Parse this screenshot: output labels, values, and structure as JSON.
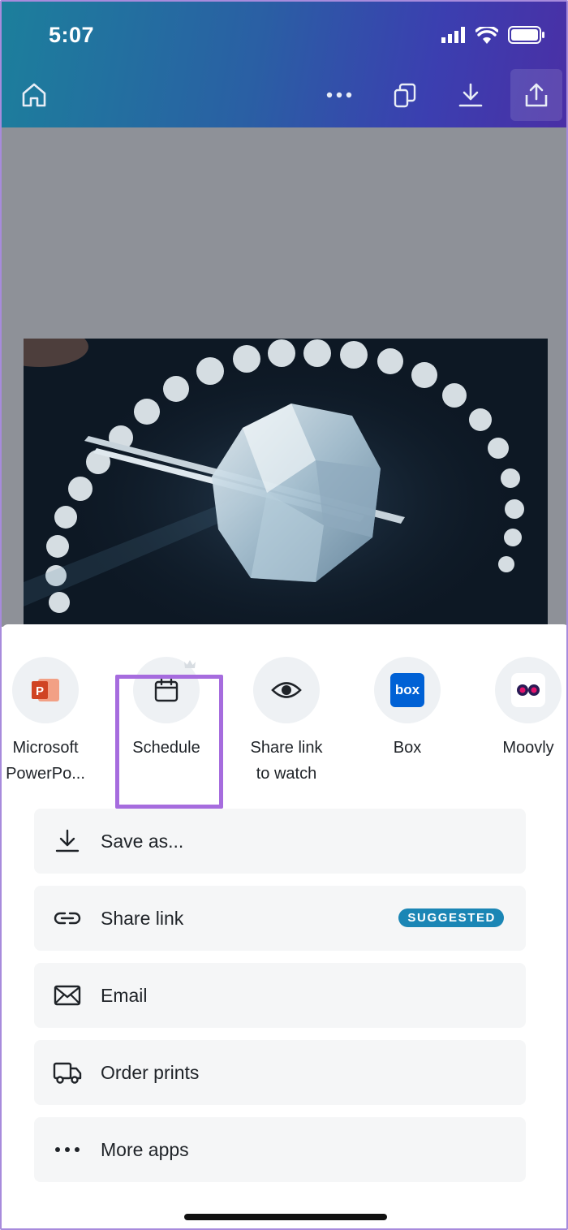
{
  "status": {
    "time": "5:07"
  },
  "toolbar": {
    "home": "home-icon",
    "more": "more-icon",
    "pages": "pages-icon",
    "download": "download-icon",
    "share": "share-icon"
  },
  "apps": [
    {
      "label": "Microsoft PowerPo...",
      "label_line1": "Microsoft",
      "label_line2": "PowerPo...",
      "icon": "powerpoint-icon",
      "color": "#d04423"
    },
    {
      "label": "Schedule",
      "icon": "calendar-icon",
      "premium": true
    },
    {
      "label": "Share link to watch",
      "label_line1": "Share link",
      "label_line2": "to watch",
      "icon": "eye-icon"
    },
    {
      "label": "Box",
      "icon": "box-logo-icon",
      "logo_text": "box",
      "color": "#0061d5"
    },
    {
      "label": "Moovly",
      "icon": "moovly-icon",
      "color": "#e3136c"
    }
  ],
  "actions": [
    {
      "label": "Save as...",
      "icon": "download-icon"
    },
    {
      "label": "Share link",
      "icon": "link-icon",
      "badge": "SUGGESTED"
    },
    {
      "label": "Email",
      "icon": "envelope-icon"
    },
    {
      "label": "Order prints",
      "icon": "truck-icon"
    },
    {
      "label": "More apps",
      "icon": "more-icon"
    }
  ],
  "colors": {
    "highlight": "#a66cde",
    "badge": "#1b86b5",
    "header_start": "#1c7f9c",
    "header_end": "#4a2fa5"
  }
}
